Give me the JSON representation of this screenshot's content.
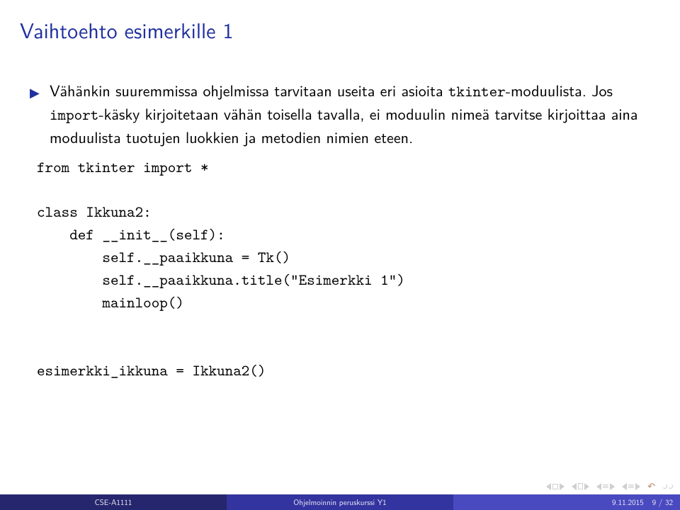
{
  "title": "Vaihtoehto esimerkille 1",
  "bullets": [
    {
      "pre": "Vähänkin suuremmissa ohjelmissa tarvitaan useita eri asioita ",
      "mono1": "tkinter",
      "mid": "-moduulista. Jos ",
      "mono2": "import",
      "post": "-käsky kirjoitetaan vähän toisella tavalla, ei moduulin nimeä tarvitse kirjoittaa aina moduulista tuotujen luokkien ja metodien nimien eteen."
    }
  ],
  "code": "from tkinter import *\n\nclass Ikkuna2:\n    def __init__(self):\n        self.__paaikkuna = Tk()\n        self.__paaikkuna.title(\"Esimerkki 1\")\n        mainloop()\n\n\nesimerkki_ikkuna = Ikkuna2()",
  "footer": {
    "left": "CSE-A1111",
    "center": "Ohjelmoinnin peruskurssi Y1",
    "date": "9.11.2015",
    "page": "9 / 32"
  }
}
